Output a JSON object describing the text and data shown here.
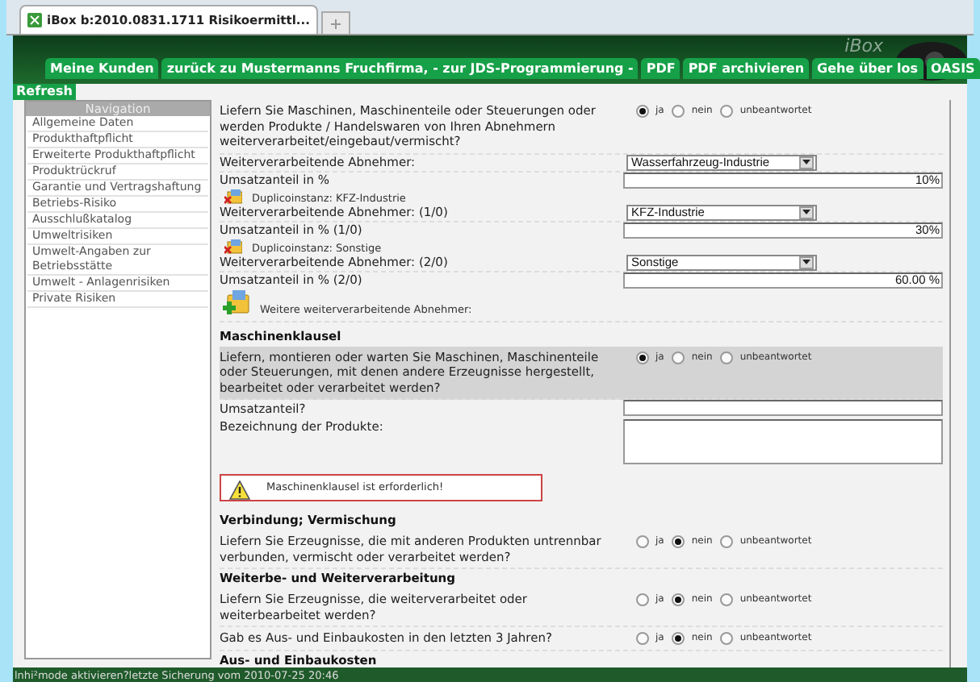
{
  "browser_tab": {
    "title": "iBox b:2010.0831.1711 Risikoermittl..."
  },
  "logo": "iBox",
  "menu": [
    {
      "label": "Meine Kunden"
    },
    {
      "label": "zurück zu Mustermanns Fruchfirma, - zur JDS-Programmierung -"
    },
    {
      "label": "PDF"
    },
    {
      "label": "PDF archivieren"
    },
    {
      "label": "Gehe über los"
    },
    {
      "label": "OASIS"
    }
  ],
  "refresh": "Refresh",
  "navigation": {
    "title": "Navigation",
    "items": [
      "Allgemeine Daten",
      "Produkthaftpflicht",
      "Erweiterte Produkthaftpflicht",
      "Produktrückruf",
      "Garantie und Vertragshaftung",
      "Betriebs-Risiko",
      "Ausschlußkatalog",
      "Umweltrisiken",
      "Umwelt-Angaben zur Betriebsstätte",
      "Umwelt - Anlagenrisiken",
      "Private Risiken"
    ]
  },
  "rows": [
    {
      "kind": "question",
      "text": "Liefern Sie Maschinen, Maschinenteile oder Steuerungen oder werden Produkte / Handelswaren von Ihren Abnehmern weiterverarbeitet/eingebaut/vermischt?",
      "highlighted": false,
      "options": [
        {
          "label": "ja",
          "selected": true
        },
        {
          "label": "nein",
          "selected": false
        },
        {
          "label": "unbeantwortet",
          "selected": false
        }
      ]
    },
    {
      "kind": "select",
      "label": "Weiterverarbeitende Abnehmer:",
      "value": "Wasserfahrzeug-Industrie"
    },
    {
      "kind": "input",
      "label": "Umsatzanteil in %",
      "value": "10%"
    },
    {
      "kind": "duplicate",
      "label": "Duplicoinstanz: KFZ-Industrie"
    },
    {
      "kind": "select",
      "label": "Weiterverarbeitende Abnehmer: (1/0)",
      "value": "KFZ-Industrie"
    },
    {
      "kind": "input",
      "label": "Umsatzanteil in % (1/0)",
      "value": "30%"
    },
    {
      "kind": "duplicate",
      "label": "Duplicoinstanz: Sonstige"
    },
    {
      "kind": "select",
      "label": "Weiterverarbeitende Abnehmer: (2/0)",
      "value": "Sonstige"
    },
    {
      "kind": "input",
      "label": "Umsatzanteil in % (2/0)",
      "value": "60.00 %"
    },
    {
      "kind": "add",
      "label": "Weitere weiterverarbeitende Abnehmer:"
    },
    {
      "kind": "heading",
      "text": "Maschinenklausel"
    },
    {
      "kind": "question",
      "text": "Liefern, montieren oder warten Sie Maschinen, Maschinenteile oder Steuerungen, mit denen andere Erzeugnisse hergestellt, bearbeitet oder verarbeitet werden?",
      "highlighted": true,
      "options": [
        {
          "label": "ja",
          "selected": true
        },
        {
          "label": "nein",
          "selected": false
        },
        {
          "label": "unbeantwortet",
          "selected": false
        }
      ]
    },
    {
      "kind": "input",
      "label": "Umsatzanteil?"
    },
    {
      "kind": "textarea",
      "label": "Bezeichnung der Produkte:"
    },
    {
      "kind": "warning",
      "text": "Maschinenklausel ist erforderlich!"
    },
    {
      "kind": "heading",
      "text": "Verbindung; Vermischung"
    },
    {
      "kind": "question",
      "text": "Liefern Sie Erzeugnisse, die mit anderen Produkten untrennbar verbunden, vermischt oder verarbeitet werden?",
      "highlighted": false,
      "options": [
        {
          "label": "ja",
          "selected": false
        },
        {
          "label": "nein",
          "selected": true
        },
        {
          "label": "unbeantwortet",
          "selected": false
        }
      ]
    },
    {
      "kind": "heading",
      "text": "Weiterbe- und Weiterverarbeitung"
    },
    {
      "kind": "question",
      "text": "Liefern Sie Erzeugnisse, die weiterverarbeitet oder weiterbearbeitet werden?",
      "highlighted": false,
      "options": [
        {
          "label": "ja",
          "selected": false
        },
        {
          "label": "nein",
          "selected": true
        },
        {
          "label": "unbeantwortet",
          "selected": false
        }
      ]
    },
    {
      "kind": "question",
      "text": "Gab es Aus- und Einbaukosten in den letzten 3 Jahren?",
      "highlighted": false,
      "options": [
        {
          "label": "ja",
          "selected": false
        },
        {
          "label": "nein",
          "selected": true
        },
        {
          "label": "unbeantwortet",
          "selected": false
        }
      ]
    },
    {
      "kind": "heading",
      "text": "Aus- und Einbaukosten"
    }
  ],
  "status_bar": "lnhi²mode aktivieren?letzte Sicherung vom 2010-07-25 20:46"
}
